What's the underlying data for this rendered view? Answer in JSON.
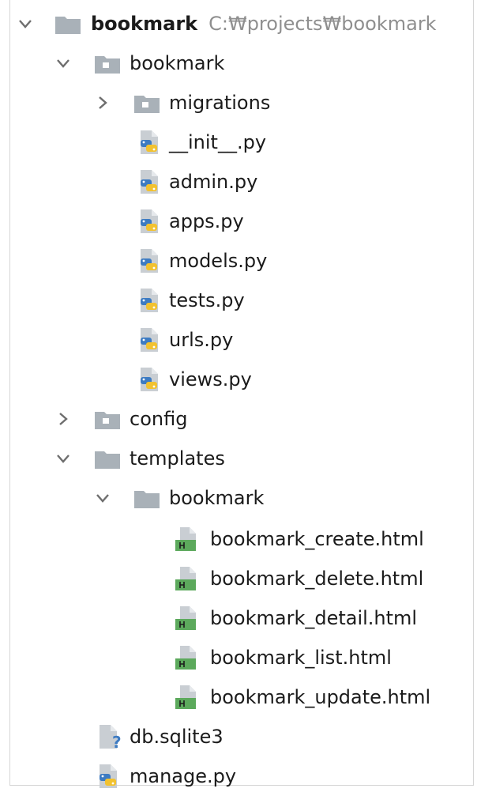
{
  "project": {
    "name": "bookmark",
    "path": "C:₩projects₩bookmark"
  },
  "tree": [
    {
      "label": "bookmark",
      "icon": "folder-icon",
      "expanded": true
    },
    {
      "label": "migrations",
      "icon": "folder-icon",
      "expanded": false
    },
    {
      "label": "__init__.py",
      "icon": "python-file-icon"
    },
    {
      "label": "admin.py",
      "icon": "python-file-icon"
    },
    {
      "label": "apps.py",
      "icon": "python-file-icon"
    },
    {
      "label": "models.py",
      "icon": "python-file-icon"
    },
    {
      "label": "tests.py",
      "icon": "python-file-icon"
    },
    {
      "label": "urls.py",
      "icon": "python-file-icon"
    },
    {
      "label": "views.py",
      "icon": "python-file-icon"
    },
    {
      "label": "config",
      "icon": "folder-icon",
      "expanded": false
    },
    {
      "label": "templates",
      "icon": "folder-icon",
      "expanded": true
    },
    {
      "label": "bookmark",
      "icon": "folder-icon",
      "expanded": true
    },
    {
      "label": "bookmark_create.html",
      "icon": "html-file-icon"
    },
    {
      "label": "bookmark_delete.html",
      "icon": "html-file-icon"
    },
    {
      "label": "bookmark_detail.html",
      "icon": "html-file-icon"
    },
    {
      "label": "bookmark_list.html",
      "icon": "html-file-icon"
    },
    {
      "label": "bookmark_update.html",
      "icon": "html-file-icon"
    },
    {
      "label": "db.sqlite3",
      "icon": "unknown-file-icon"
    },
    {
      "label": "manage.py",
      "icon": "python-file-icon"
    }
  ],
  "colors": {
    "folder": "#a9b1b8",
    "python_blue": "#3d7bc2",
    "python_yellow": "#f2c230",
    "html_green": "#5ca95c",
    "unknown_blue": "#3d7bc2",
    "path_gray": "#8f8f8f"
  }
}
